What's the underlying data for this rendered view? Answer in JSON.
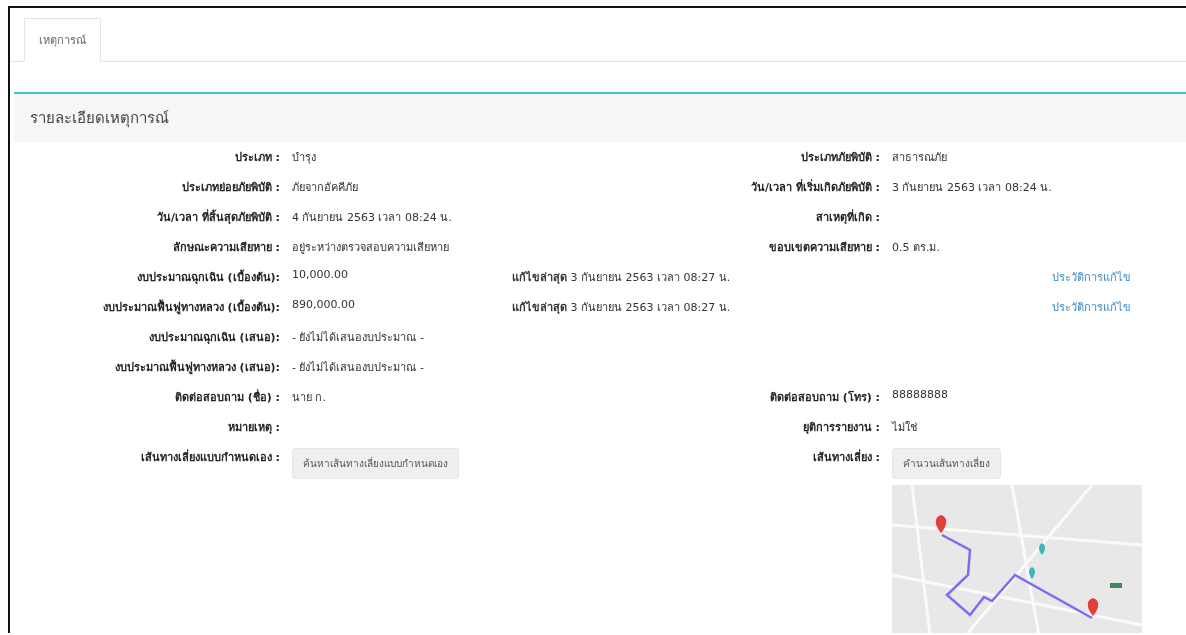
{
  "tabs": [
    {
      "label": "เหตุการณ์",
      "selected": true
    }
  ],
  "panel": {
    "title": "รายละเอียดเหตุการณ์"
  },
  "rows": [
    {
      "kind": "pair",
      "left": {
        "label": "ประเภท :",
        "value": "บำรุง"
      },
      "right": {
        "label": "ประเภทภัยพิบัติ :",
        "value": "สาธารณภัย"
      }
    },
    {
      "kind": "pair",
      "left": {
        "label": "ประเภทย่อยภัยพิบัติ :",
        "value": "ภัยจากอัคคีภัย"
      },
      "right": {
        "label": "วัน/เวลา ที่เริ่มเกิดภัยพิบัติ :",
        "value": "3 กันยายน 2563 เวลา 08:24 น."
      }
    },
    {
      "kind": "pair",
      "left": {
        "label": "วัน/เวลา ที่สิ้นสุดภัยพิบัติ :",
        "value": "4 กันยายน 2563 เวลา 08:24 น."
      },
      "right": {
        "label": "สาเหตุที่เกิด :"
      }
    },
    {
      "kind": "pair",
      "left": {
        "label": "ลักษณะความเสียหาย :",
        "value": "อยู่ระหว่างตรวจสอบความเสียหาย"
      },
      "right": {
        "label": "ขอบเขตความเสียหาย :",
        "value": "0.5 ตร.ม."
      }
    },
    {
      "kind": "budget",
      "left": {
        "label": "งบประมาณฉุกเฉิน (เบื้องต้น):",
        "value": "10,000.00"
      },
      "edited": "**แก้ไขล่าสุด** 3 กันยายน 2563 เวลา 08:27 น.",
      "link": "ประวัติการแก้ไข"
    },
    {
      "kind": "budget",
      "left": {
        "label": "งบประมาณฟื้นฟูทางหลวง (เบื้องต้น):",
        "value": "890,000.00"
      },
      "edited": "**แก้ไขล่าสุด** 3 กันยายน 2563 เวลา 08:27 น.",
      "link": "ประวัติการแก้ไข"
    },
    {
      "kind": "pair",
      "left": {
        "label": "งบประมาณฉุกเฉิน (เสนอ):",
        "value": "- ยังไม่ได้เสนองบประมาณ -"
      }
    },
    {
      "kind": "pair",
      "left": {
        "label": "งบประมาณฟื้นฟูทางหลวง (เสนอ):",
        "value": "- ยังไม่ได้เสนองบประมาณ -"
      }
    },
    {
      "kind": "pair",
      "left": {
        "label": "ติดต่อสอบถาม (ชื่อ) :",
        "value": "นาย ก."
      },
      "right": {
        "label": "ติดต่อสอบถาม (โทร) :",
        "value": "88888888"
      }
    },
    {
      "kind": "pair",
      "left": {
        "label": "หมายเหตุ :"
      },
      "right": {
        "label": "ยุติการรายงาน :",
        "value": "ไม่ใช่"
      }
    },
    {
      "kind": "route",
      "left": {
        "label": "เส้นทางเลี่ยงแบบกำหนดเอง :",
        "button": "ค้นหาเส้นทางเลี่ยงแบบกำหนดเอง"
      },
      "right": {
        "label": "เส้นทางเลี่ยง :",
        "button": "คำนวนเส้นทางเลี่ยง"
      }
    }
  ]
}
